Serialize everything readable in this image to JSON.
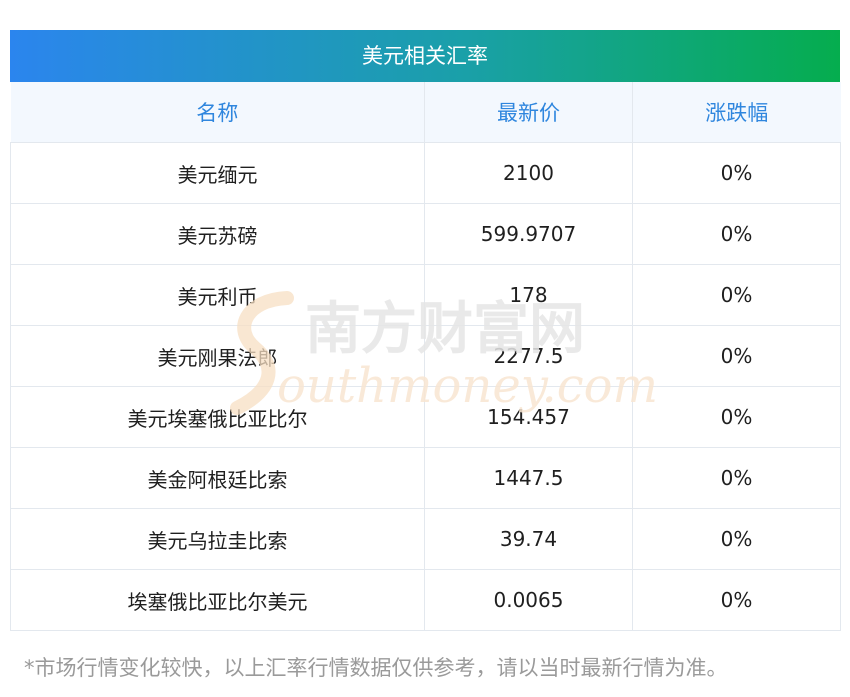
{
  "title": "美元相关汇率",
  "columns": [
    "名称",
    "最新价",
    "涨跌幅"
  ],
  "rows": [
    {
      "name": "美元缅元",
      "price": "2100",
      "change": "0%"
    },
    {
      "name": "美元苏磅",
      "price": "599.9707",
      "change": "0%"
    },
    {
      "name": "美元利币",
      "price": "178",
      "change": "0%"
    },
    {
      "name": "美元刚果法郎",
      "price": "2277.5",
      "change": "0%"
    },
    {
      "name": "美元埃塞俄比亚比尔",
      "price": "154.457",
      "change": "0%"
    },
    {
      "name": "美金阿根廷比索",
      "price": "1447.5",
      "change": "0%"
    },
    {
      "name": "美元乌拉圭比索",
      "price": "39.74",
      "change": "0%"
    },
    {
      "name": "埃塞俄比亚比尔美元",
      "price": "0.0065",
      "change": "0%"
    }
  ],
  "watermark": {
    "cn": "南方财富网",
    "en": "outhmoney.com"
  },
  "footnote": "*市场行情变化较快，以上汇率行情数据仅供参考，请以当时最新行情为准。",
  "colors": {
    "title_gradient_start": "#2b85ee",
    "title_gradient_end": "#05ad4e",
    "header_text": "#2f86de",
    "header_bg": "#f3f8fe"
  }
}
